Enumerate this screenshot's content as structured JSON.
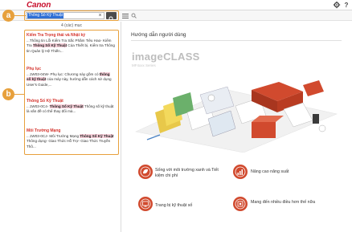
{
  "header": {
    "brand": "Canon"
  },
  "search": {
    "query": "Thông Số Kỹ Thuật",
    "results_count": "4 (các) mục"
  },
  "callouts": {
    "a": "a",
    "b": "b"
  },
  "results": [
    {
      "title": "Kiểm Tra Trọng thái và Nhật ký",
      "snippet_before": "...Thông tin Lỗi Kiểm Tra Sắc Phầm Tiêu Hao- Kiểm Tra ",
      "hit": "Thông Số Kỹ Thuật",
      "snippet_after": " Của Thiết bị. Kiểm tra Thông tin Quản lý Hệ Thiến..."
    },
    {
      "title": "Phụ lục",
      "snippet_before": "...1W03-04W- Phụ lục: Chương này gồm có ",
      "hit": "thông số kỹ thuật",
      "snippet_after": " của máy này, hướng dẫn cách sử dụng User's Guide,..."
    },
    {
      "title": "Thông Số Kỹ Thuật",
      "snippet_before": "...1W03-0C4- ",
      "hit": "Thông Số Kỹ Thuật",
      "snippet_after": " Thông số kỹ thuật là vấn đề có thể thay đổi mà..."
    },
    {
      "title": "Môi Trường Mạng",
      "snippet_before": "...1W03-0CJ- Môi Trường Mạng ",
      "hit": "Thông Số Kỹ Thuật",
      "snippet_after": " Thông dụng- Giao Thức Hỗ Trợ- Giao Thức Truyền Thô..."
    }
  ],
  "main": {
    "guide_title": "Hướng dẫn người dùng",
    "product_name": "imageCLASS",
    "product_sub": "MF4xxx Series"
  },
  "features": [
    {
      "label": "Sống với môi trường xanh và Tiết kiệm chi phí",
      "icon": "leaf-icon"
    },
    {
      "label": "Nâng cao năng suất",
      "icon": "bar-chart-icon"
    },
    {
      "label": "Trang bị kỹ thuật số",
      "icon": "monitor-icon"
    },
    {
      "label": "Mang đến nhiều điều hơn thế nữa",
      "icon": "tools-icon"
    }
  ],
  "colors": {
    "brand_red": "#c8102e",
    "callout_orange": "#e7a03c",
    "feature_red": "#d14a2e",
    "highlight_pink": "#f7cfd9",
    "selection_blue": "#2e6fd6"
  }
}
